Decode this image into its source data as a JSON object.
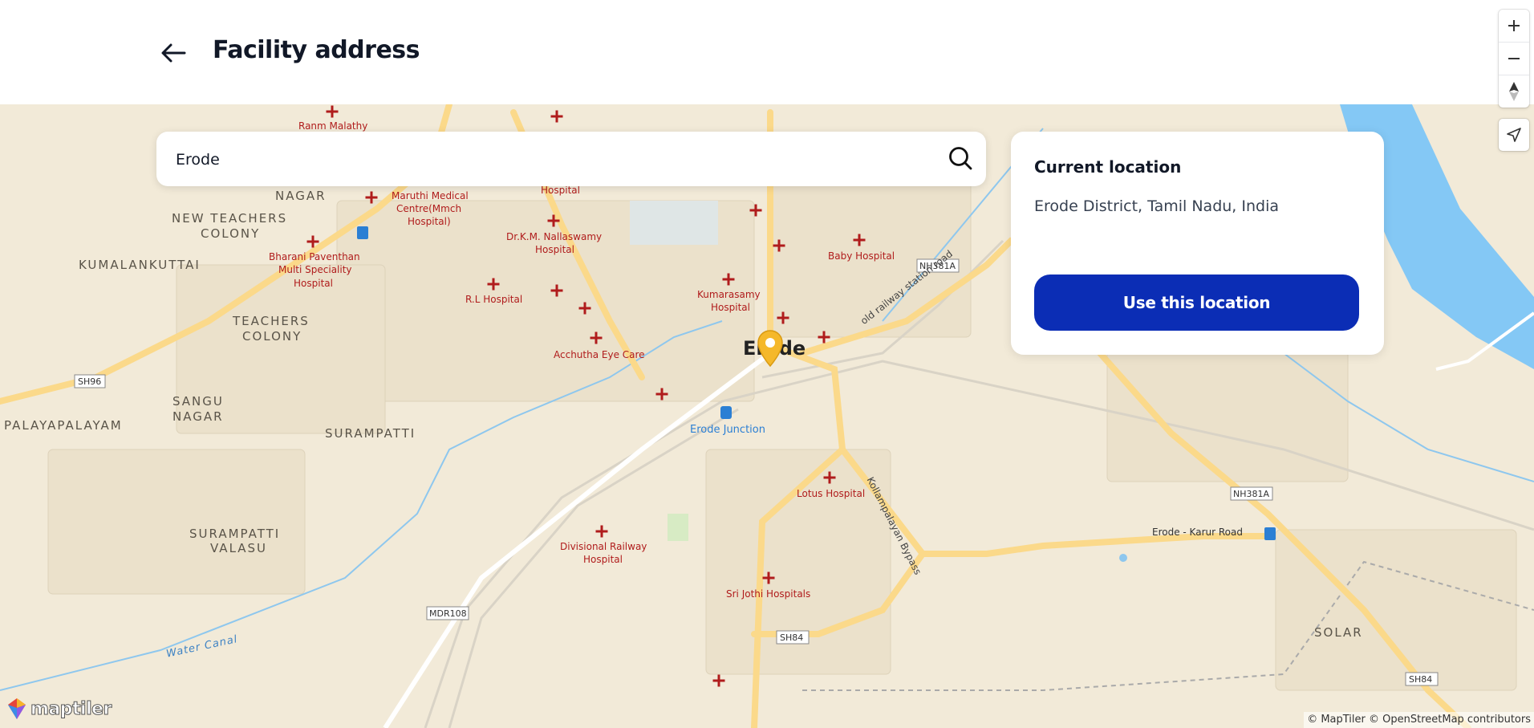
{
  "header": {
    "back_icon": "arrow-left-icon",
    "title": "Facility address"
  },
  "search": {
    "value": "Erode",
    "icon": "search-icon"
  },
  "location_card": {
    "heading": "Current location",
    "address": "Erode District, Tamil Nadu, India",
    "button_label": "Use this location"
  },
  "map_controls": {
    "zoom_in": "+",
    "zoom_out": "−",
    "compass_icon": "compass-icon",
    "locate_icon": "navigation-arrow-icon"
  },
  "map": {
    "place_labels": [
      "NAGAR",
      "NEW TEACHERS",
      "COLONY",
      "KUMALANKUTTAI",
      "TEACHERS",
      "COLONY",
      "SANGU",
      "NAGAR",
      "PALAYAPALAYAM",
      "SURAMPATTI",
      "SURAMPATTI",
      "VALASU",
      "SOLAR"
    ],
    "city_label": "Erode",
    "poi_labels": [
      "Ranm Malathy",
      "Hospital",
      "Maruthi Medical",
      "Centre(Mmch",
      "Hospital)",
      "Bharani Paventhan",
      "Multi Speciality",
      "Hospital",
      "Dr.K.M. Nallaswamy",
      "Hospital",
      "R.L Hospital",
      "Acchutha Eye Care",
      "Kumarasamy",
      "Hospital",
      "Baby Hospital",
      "Lotus Hospital",
      "Divisional Railway",
      "Hospital",
      "Sri Jothi Hospitals"
    ],
    "station_label": "Erode Junction",
    "road_labels": [
      "old railway station road",
      "Kollampalayan Bypass",
      "Erode - Karur Road",
      "Water Canal"
    ],
    "road_shields": [
      "SH96",
      "NH381A",
      "NH381A",
      "MDR108",
      "SH84",
      "SH84"
    ],
    "colors": {
      "land": "#f2ead8",
      "water": "#84c8f5",
      "road_major": "#fbd98a",
      "poi": "#b01c1c",
      "station": "#2b7fd4",
      "accent_button": "#0b2db5"
    }
  },
  "attribution": "© MapTiler © OpenStreetMap contributors",
  "logo_text": "maptiler"
}
